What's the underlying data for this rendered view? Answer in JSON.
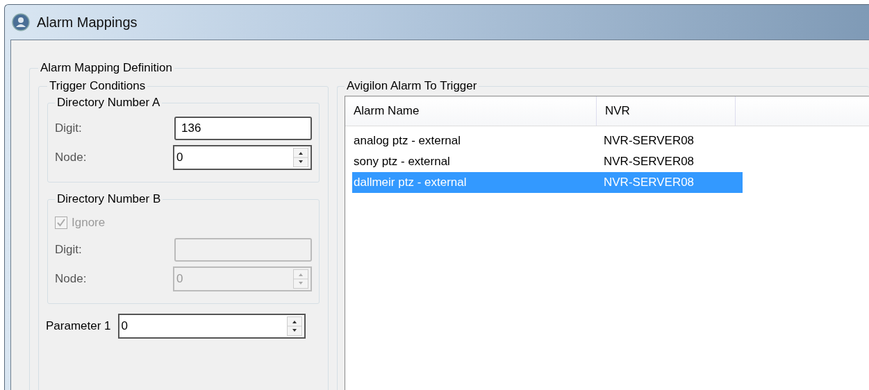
{
  "window": {
    "title": "Alarm Mappings"
  },
  "definition": {
    "title": "Alarm Mapping Definition",
    "trigger_conditions": {
      "title": "Trigger Conditions",
      "groups": [
        {
          "title": "Directory Number A",
          "fields": [
            {
              "label": "Digit:",
              "kind": "text",
              "value": "136",
              "disabled": false
            },
            {
              "label": "Node:",
              "kind": "spinner",
              "value": "0",
              "disabled": false
            }
          ]
        },
        {
          "title": "Directory Number B",
          "checkbox": {
            "label": "Ignore",
            "checked": true,
            "disabled": true
          },
          "fields": [
            {
              "label": "Digit:",
              "kind": "text",
              "disabled": true
            },
            {
              "label": "Node:",
              "kind": "spinner",
              "value": "0",
              "disabled": true
            }
          ]
        }
      ],
      "parameter": {
        "label": "Parameter 1",
        "value": "0"
      }
    },
    "alarm_to_trigger": {
      "title": "Avigilon Alarm To Trigger",
      "columns": [
        "Alarm Name",
        "NVR"
      ],
      "rows": [
        {
          "cells": [
            "analog ptz - external",
            "NVR-SERVER08"
          ],
          "selected": false
        },
        {
          "cells": [
            "sony ptz - external",
            "NVR-SERVER08"
          ],
          "selected": false
        },
        {
          "cells": [
            "dallmeir ptz - external",
            "NVR-SERVER08"
          ],
          "selected": true
        }
      ]
    }
  }
}
